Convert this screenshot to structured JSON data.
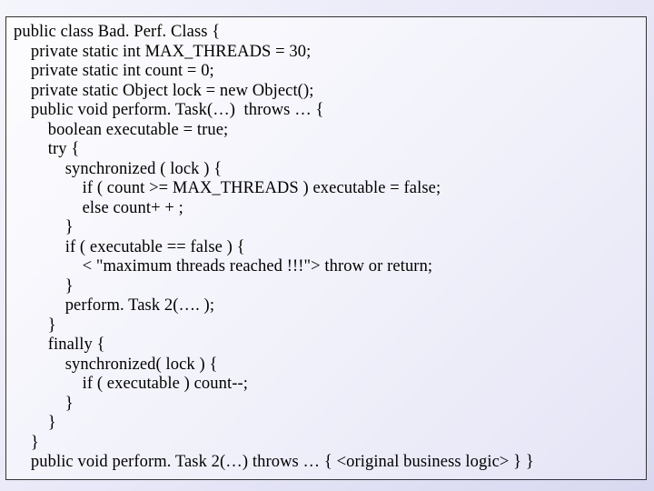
{
  "code": {
    "lines": [
      "public class Bad. Perf. Class {",
      "    private static int MAX_THREADS = 30;",
      "    private static int count = 0;",
      "    private static Object lock = new Object();",
      "    public void perform. Task(…)  throws … {",
      "        boolean executable = true;",
      "        try {",
      "            synchronized ( lock ) {",
      "                if ( count >= MAX_THREADS ) executable = false;",
      "                else count+ + ;",
      "            }",
      "            if ( executable == false ) {",
      "                < \"maximum threads reached !!!\"> throw or return;",
      "            }",
      "            perform. Task 2(…. );",
      "        }",
      "        finally {",
      "            synchronized( lock ) {",
      "                if ( executable ) count--;",
      "            }",
      "        }",
      "    }",
      "    public void perform. Task 2(…) throws … { <original business logic> } }"
    ]
  }
}
